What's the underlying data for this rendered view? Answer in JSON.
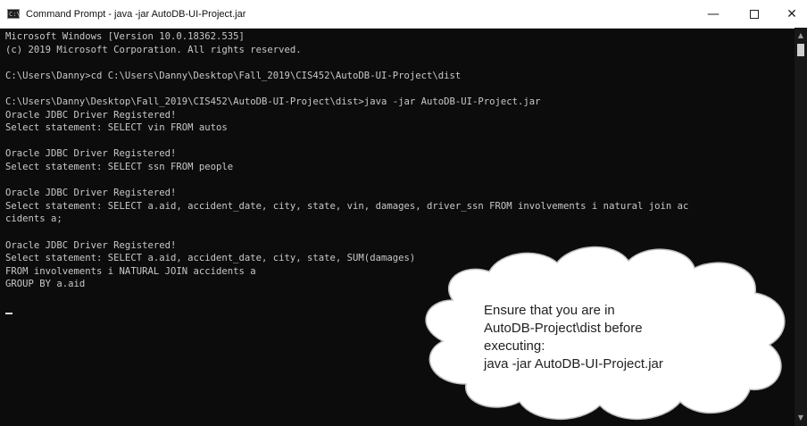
{
  "window": {
    "title": "Command Prompt - java  -jar AutoDB-UI-Project.jar",
    "controls": {
      "minimize": "—",
      "close": "✕"
    }
  },
  "console": {
    "lines": [
      "Microsoft Windows [Version 10.0.18362.535]",
      "(c) 2019 Microsoft Corporation. All rights reserved.",
      "",
      "C:\\Users\\Danny>cd C:\\Users\\Danny\\Desktop\\Fall_2019\\CIS452\\AutoDB-UI-Project\\dist",
      "",
      "C:\\Users\\Danny\\Desktop\\Fall_2019\\CIS452\\AutoDB-UI-Project\\dist>java -jar AutoDB-UI-Project.jar",
      "Oracle JDBC Driver Registered!",
      "Select statement: SELECT vin FROM autos",
      "",
      "Oracle JDBC Driver Registered!",
      "Select statement: SELECT ssn FROM people",
      "",
      "Oracle JDBC Driver Registered!",
      "Select statement: SELECT a.aid, accident_date, city, state, vin, damages, driver_ssn FROM involvements i natural join ac",
      "cidents a;",
      "",
      "Oracle JDBC Driver Registered!",
      "Select statement: SELECT a.aid, accident_date, city, state, SUM(damages)",
      "FROM involvements i NATURAL JOIN accidents a",
      "GROUP BY a.aid"
    ]
  },
  "callout": {
    "text": "Ensure that you are in\nAutoDB-Project\\dist before\nexecuting:\njava -jar AutoDB-UI-Project.jar"
  },
  "colors": {
    "console_bg": "#0c0c0c",
    "console_text": "#c8c8c8",
    "titlebar_bg": "#ffffff",
    "callout_fill": "#ffffff",
    "callout_stroke": "#bfbfbf"
  }
}
